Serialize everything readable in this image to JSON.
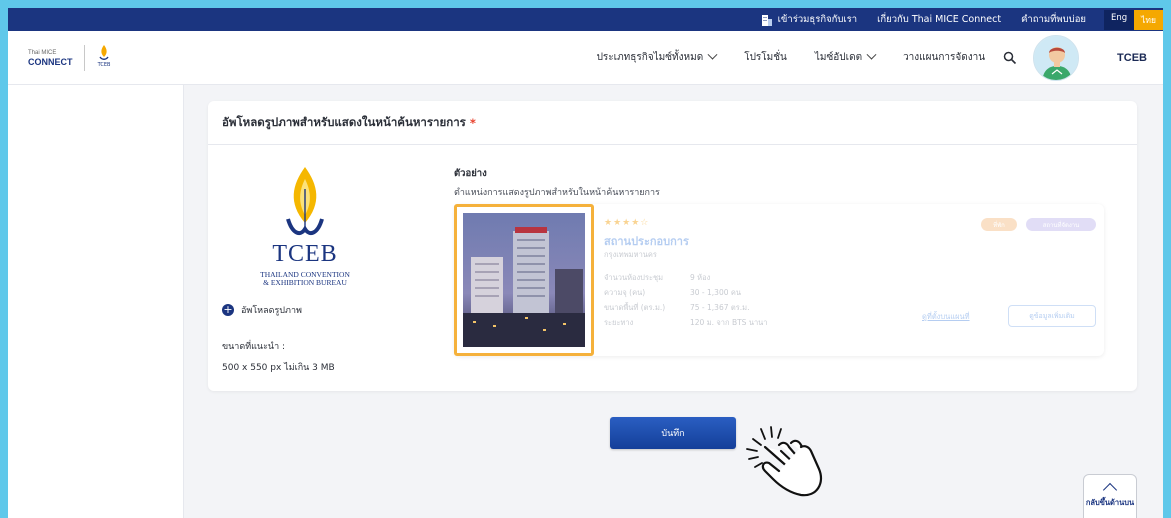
{
  "utility_bar": {
    "join_business": "เข้าร่วมธุรกิจกับเรา",
    "about": "เกี่ยวกับ Thai MICE Connect",
    "faq": "คำถามที่พบบ่อย",
    "lang_eng": "Eng",
    "lang_thai": "ไทย"
  },
  "logo": {
    "mice_line1": "Thai MICE",
    "mice_line2": "CONNECT",
    "tceb_small": "TCEB"
  },
  "nav": {
    "business_types": "ประเภทธุรกิจไมซ์ทั้งหมด",
    "promotions": "โปรโมชั่น",
    "mice_update": "ไมซ์อัปเดต",
    "plan_event": "วางแผนการจัดงาน",
    "user_name": "TCEB"
  },
  "card": {
    "header": "อัพโหลดรูปภาพสำหรับแสดงในหน้าค้นหารายการ",
    "required_mark": "*",
    "upload_label": "อัพโหลดรูปภาพ",
    "size_label": "ขนาดที่แนะนำ :",
    "size_value": "500 x 550 px ไม่เกิน 3 MB",
    "tceb_logo_text": "TCEB",
    "tceb_logo_sub1": "THAILAND CONVENTION",
    "tceb_logo_sub2": "& EXHIBITION BUREAU",
    "example_title": "ตัวอย่าง",
    "example_desc": "ตำแหน่งการแสดงรูปภาพสำหรับในหน้าค้นหารายการ"
  },
  "preview": {
    "stars": "★★★★☆",
    "venue_name": "สถานประกอบการ",
    "venue_location": "กรุงเทพมหานคร",
    "specs": [
      {
        "key": "จำนวนห้องประชุม",
        "value": "9 ห้อง"
      },
      {
        "key": "ความจุ (คน)",
        "value": "30 - 1,300 คน"
      },
      {
        "key": "ขนาดพื้นที่ (ตร.ม.)",
        "value": "75 - 1,367 ตร.ม."
      },
      {
        "key": "ระยะทาง",
        "value": "120 ม. จาก BTS นานา"
      }
    ],
    "badge_orange": "ที่พัก",
    "badge_purple": "สถานที่จัดงาน",
    "map_link": "ดูที่ตั้งบนแผนที่",
    "detail_button": "ดูข้อมูลเพิ่มเติม"
  },
  "actions": {
    "save": "บันทึก",
    "back_to_top": "กลับขึ้นด้านบน"
  },
  "colors": {
    "navy": "#1b3580",
    "accent_orange": "#f5a800",
    "bg_cyan": "#5fc8ea"
  }
}
